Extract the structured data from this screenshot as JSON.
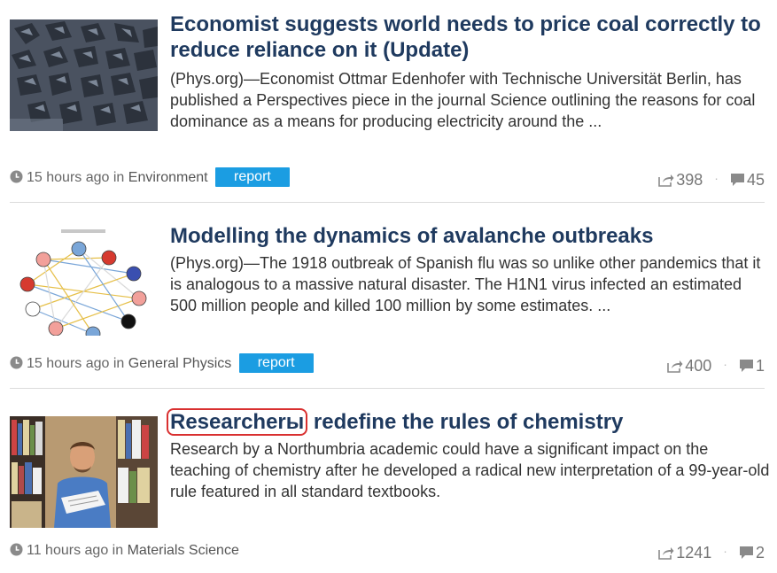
{
  "articles": [
    {
      "title": "Economist suggests world needs to price coal correctly to reduce reliance on it (Update)",
      "summary": "(Phys.org)—Economist Ottmar Edenhofer with Technische Universität Berlin, has published a Perspectives piece in the journal Science outlining the reasons for coal dominance as a means for producing electricity around the ...",
      "time": "15 hours ago",
      "in_word": "in",
      "category": "Environment",
      "report_label": "report",
      "shares": "398",
      "comments": "45",
      "thumbnail": "coal-photo"
    },
    {
      "title": "Modelling the dynamics of avalanche outbreaks",
      "summary": "(Phys.org)—The 1918 outbreak of Spanish flu was so unlike other pandemics that it is analogous to a massive natural disaster. The H1N1 virus infected an estimated 500 million people and killed 100 million by some estimates. ...",
      "time": "15 hours ago",
      "in_word": "in",
      "category": "General Physics",
      "report_label": "report",
      "shares": "400",
      "comments": "1",
      "thumbnail": "network-diagram"
    },
    {
      "title_highlight": "Researcherы",
      "title_rest": " redefine the rules of chemistry",
      "summary": "Research by a Northumbria academic could have a significant impact on the teaching of chemistry after he developed a radical new interpretation of a 99-year-old rule featured in all standard textbooks.",
      "time": "11 hours ago",
      "in_word": "in",
      "category": "Materials Science",
      "shares": "1241",
      "comments": "2",
      "thumbnail": "researcher-photo"
    }
  ],
  "icons": {
    "clock": "clock-icon",
    "share": "share-icon",
    "comment": "comment-icon"
  },
  "colors": {
    "title": "#1f3a5f",
    "report_bg": "#1b9de2",
    "highlight_border": "#d93030"
  }
}
